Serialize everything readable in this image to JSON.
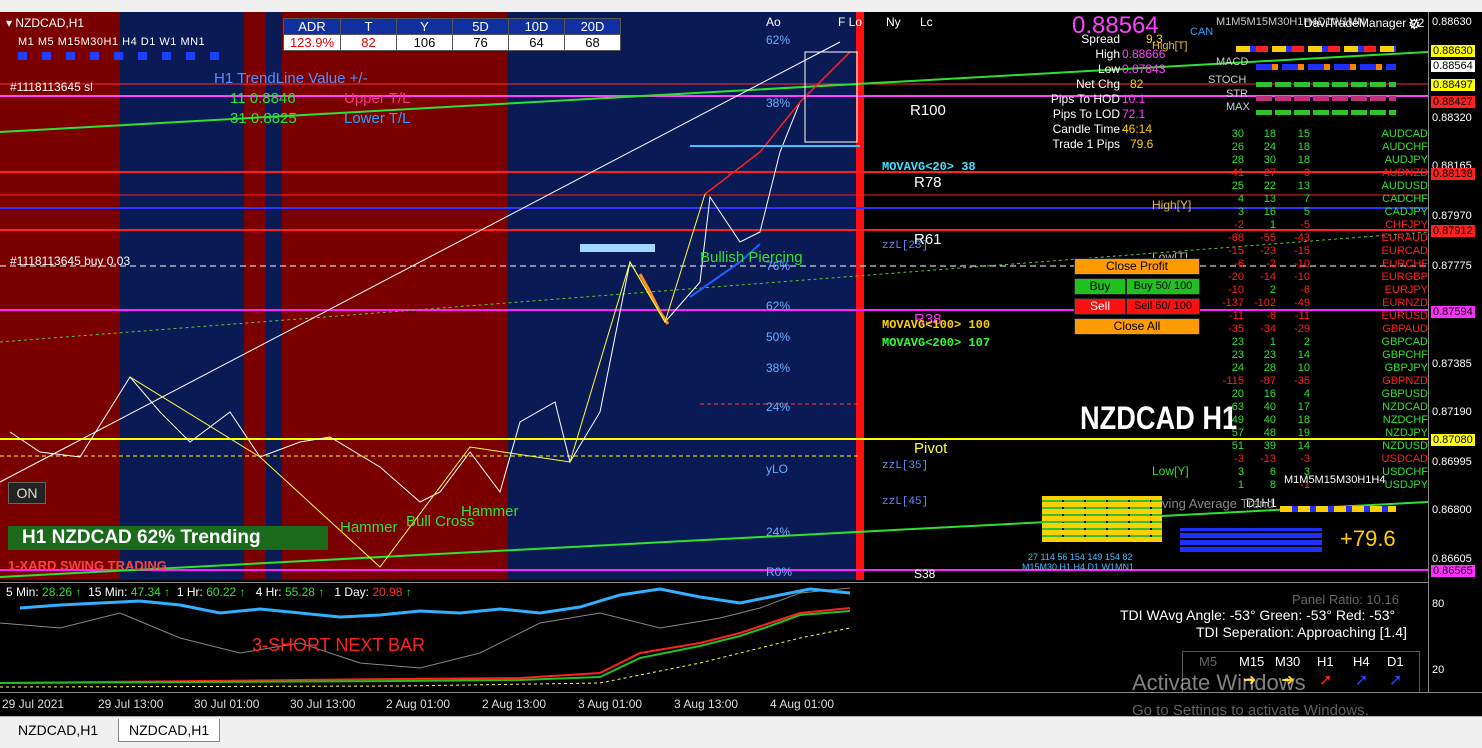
{
  "symbol_header": {
    "title": "NZDCAD,H1",
    "timeframes": [
      "M1",
      "M5",
      "M15",
      "M30",
      "H1",
      "H4",
      "D1",
      "W1",
      "MN1"
    ]
  },
  "adr_table": {
    "headers": [
      "ADR",
      "T",
      "Y",
      "5D",
      "10D",
      "20D"
    ],
    "values": [
      "123.9%",
      "82",
      "106",
      "76",
      "64",
      "68"
    ]
  },
  "info_panel": {
    "price": "0.88564",
    "rows": [
      {
        "label": "Spread",
        "value": "9.3"
      },
      {
        "label": "High",
        "value": "0.88666"
      },
      {
        "label": "Low",
        "value": "0.87843"
      },
      {
        "label": "Net Chg",
        "value": "82"
      },
      {
        "label": "Pips To HOD",
        "value": "10.1"
      },
      {
        "label": "Pips To LOD",
        "value": "72.1"
      },
      {
        "label": "Candle Time",
        "value": "46:14"
      },
      {
        "label": "Trade 1 Pips",
        "value": "79.6"
      }
    ]
  },
  "trendline": {
    "title": "H1 TrendLine Value +/-",
    "upper_val": "11   0.8846",
    "upper_label": "Upper T/L",
    "lower_val": "31   0.8825",
    "lower_label": "Lower T/L"
  },
  "order_labels": {
    "sl": "#1118113645 sl",
    "buy": "#1118113645 buy 0.03"
  },
  "trend_banner": "H1 NZDCAD 62% Trending",
  "swing_label": "1-XARD  SWING TRADING",
  "on_button": "ON",
  "big_symbol": "NZDCAD H1",
  "big_pips": "+79.6",
  "signals": {
    "short": "3-SHORT NEXT BAR",
    "hammer1": "Hammer",
    "bull_cross": "Bull Cross",
    "hammer2": "Hammer",
    "bullish": "Bullish Piercing"
  },
  "levels": {
    "r100": "R100",
    "r78": "R78",
    "r61": "R61",
    "r38": "R38",
    "pivot": "Pivot",
    "s38": "S38",
    "high_y": "High[Y]",
    "low_y": "Low[Y]",
    "low_t": "Low[T]",
    "high_t": "High[T]"
  },
  "fib": [
    "62%",
    "50%",
    "38%",
    "24%",
    "76%",
    "62%",
    "50%",
    "38%",
    "24%",
    "yLO",
    "24%",
    "R0%"
  ],
  "movavg": {
    "m20": "MOVAVG<20> 38",
    "m100": "MOVAVG<100> 100",
    "m200": "MOVAVG<200> 107"
  },
  "zz": {
    "zz1": "zzL[23]",
    "zz2": "zzL[35]",
    "zz3": "zzL[45]"
  },
  "trade_manager": {
    "title": "DaviTradeManager V2",
    "close_profit": "Close Profit",
    "buy": "Buy",
    "buy_lot": "Buy  50/ 100",
    "sell": "Sell",
    "sell_lot": "Sell  50/ 100",
    "close_all": "Close All"
  },
  "currency_strength": {
    "rows": [
      [
        "30",
        "18",
        "15",
        "AUDCAD"
      ],
      [
        "26",
        "24",
        "18",
        "AUDCHF"
      ],
      [
        "28",
        "30",
        "18",
        "AUDJPY"
      ],
      [
        "-41",
        "-27",
        "-3",
        "AUDNZD"
      ],
      [
        "25",
        "22",
        "13",
        "AUDUSD"
      ],
      [
        "4",
        "13",
        "7",
        "CADCHF"
      ],
      [
        "3",
        "16",
        "5",
        "CADJPY"
      ],
      [
        "-2",
        "1",
        "-5",
        "CHFJPY"
      ],
      [
        "-68",
        "-55",
        "-43",
        "EURAUD"
      ],
      [
        "-15",
        "-23",
        "-15",
        "EURCAD"
      ],
      [
        "-6",
        "-2",
        "-10",
        "EURCHF"
      ],
      [
        "-20",
        "-14",
        "-10",
        "EURGBP"
      ],
      [
        "-10",
        "2",
        "-6",
        "EURJPY"
      ],
      [
        "-137",
        "-102",
        "-49",
        "EURNZD"
      ],
      [
        "-11",
        "-6",
        "-11",
        "EURUSD"
      ],
      [
        "-35",
        "-34",
        "-29",
        "GBPAUD"
      ],
      [
        "23",
        "1",
        "2",
        "GBPCAD"
      ],
      [
        "23",
        "23",
        "14",
        "GBPCHF"
      ],
      [
        "24",
        "28",
        "10",
        "GBPJPY"
      ],
      [
        "-115",
        "-87",
        "-35",
        "GBPNZD"
      ],
      [
        "20",
        "16",
        "4",
        "GBPUSD"
      ],
      [
        "63",
        "40",
        "17",
        "NZDCAD"
      ],
      [
        "49",
        "40",
        "18",
        "NZDCHF"
      ],
      [
        "57",
        "48",
        "19",
        "NZDJPY"
      ],
      [
        "51",
        "39",
        "14",
        "NZDUSD"
      ],
      [
        "-3",
        "-13",
        "-3",
        "USDCAD"
      ],
      [
        "3",
        "6",
        "3",
        "USDCHF"
      ],
      [
        "1",
        "8",
        "-1",
        "USDJPY"
      ]
    ]
  },
  "top_tf_header": "M1M5M15M30H1H4D1W1MN",
  "stats_rows": [
    "CAN",
    "High[T]",
    "MACD",
    "STOCH",
    "STR",
    "MAX"
  ],
  "tf_small": "M1M5M15M30H1H4",
  "d1_h1": "D1H1",
  "moving_average": "Moving Average Trend",
  "mini_bars": {
    "labels": "27 114   56 154 149 154   82",
    "tf": "M15M30  H1  H4  D1  W1MN1"
  },
  "price_axis": [
    "0.88630",
    "0.88564",
    "0.88497",
    "0.88427",
    "0.88320",
    "0.88165",
    "0.88138",
    "0.87970",
    "0.87912",
    "0.87775",
    "0.87594",
    "0.87385",
    "0.87190",
    "0.87080",
    "0.86995",
    "0.86800",
    "0.86605",
    "0.86565"
  ],
  "price_axis_low": [
    "80",
    "20"
  ],
  "time_axis": [
    "29 Jul 2021",
    "29 Jul 13:00",
    "30 Jul 01:00",
    "30 Jul 13:00",
    "2 Aug 01:00",
    "2 Aug 13:00",
    "3 Aug 01:00",
    "3 Aug 13:00",
    "4 Aug 01:00"
  ],
  "tdi": {
    "mtf": [
      {
        "label": "5 Min:",
        "value": "28.26"
      },
      {
        "label": "15 Min:",
        "value": "47.34"
      },
      {
        "label": "1 Hr:",
        "value": "60.22"
      },
      {
        "label": "4 Hr:",
        "value": "55.28"
      },
      {
        "label": "1 Day:",
        "value": "20.98"
      }
    ],
    "panel_ratio": "Panel Ratio: 10.16",
    "angle": "TDI WAvg Angle: -53°  Green: -53°  Red: -53°",
    "separation": "TDI Seperation: Approaching [1.4]",
    "tfs": [
      "M5",
      "M15",
      "M30",
      "H1",
      "H4",
      "D1"
    ]
  },
  "watermark": {
    "line1": "Activate Windows",
    "line2": "Go to Settings to activate Windows."
  },
  "tabs": [
    "NZDCAD,H1",
    "NZDCAD,H1"
  ],
  "session": [
    "Ao",
    "F Lo",
    "Ny",
    "Lc"
  ]
}
